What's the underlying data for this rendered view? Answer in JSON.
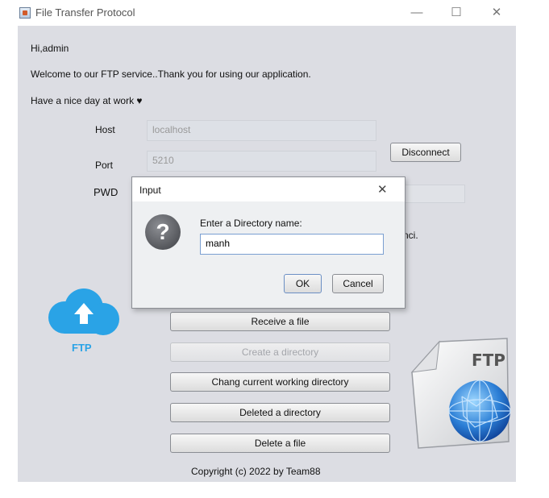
{
  "window": {
    "title": "File Transfer Protocol",
    "minimize": "—",
    "maximize": "☐",
    "close": "✕"
  },
  "greeting": {
    "hi": "Hi,admin",
    "welcome": "Welcome to our FTP service..Thank you for using our application.",
    "nice_day": "Have a nice day at work ♥"
  },
  "form": {
    "host_label": "Host",
    "host_value": "localhost",
    "port_label": "Port",
    "port_value": "5210",
    "pwd_label": "PWD",
    "disconnect_label": "Disconnect"
  },
  "partial_text": "nci.",
  "actions": {
    "receive": "Receive a file",
    "create_dir": "Create a directory",
    "change_dir": "Chang current working directory",
    "delete_dir": "Deleted a directory",
    "delete_file": "Delete a file"
  },
  "cloud_label": "FTP",
  "document_label": "FTP",
  "copyright": "Copyright (c) 2022 by Team88",
  "dialog": {
    "title": "Input",
    "close": "✕",
    "prompt": "Enter a Directory name:",
    "value": "manh",
    "ok": "OK",
    "cancel": "Cancel",
    "icon": "?"
  },
  "colors": {
    "accent_blue": "#2aa3e6",
    "panel_bg": "#dcdde3"
  }
}
